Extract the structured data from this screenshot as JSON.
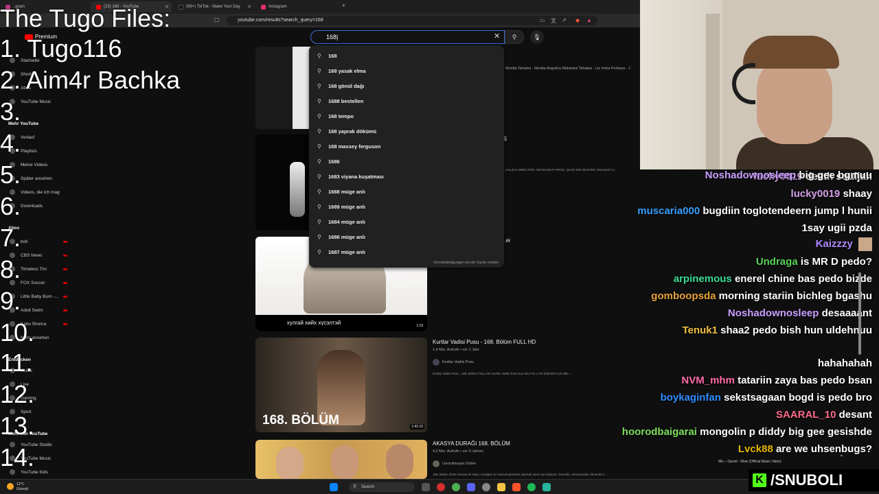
{
  "browser": {
    "tabs": [
      {
        "label": "..gram",
        "color": "#c13584"
      },
      {
        "label": "(23) 168 - YouTube",
        "color": "#ff0000"
      },
      {
        "label": "(99+) TikTok - Make Your Day",
        "color": "#111111"
      },
      {
        "label": "Instagram",
        "color": "#e1306c"
      }
    ],
    "new_tab": "+",
    "url": "youtube.com/results?search_query=168"
  },
  "overlay": {
    "title": "The Tugo Files:",
    "lines": [
      "1. Tugo116",
      "2.  Aim4r Bachka",
      "3.",
      "4.",
      "5.",
      "6.",
      "7.",
      "8.",
      "9.",
      "10.",
      "11.",
      "12.",
      "13.",
      "14."
    ]
  },
  "youtube": {
    "logo": "Premium",
    "search_value": "168",
    "sidebar": {
      "items": [
        "Startseite",
        "Shorts",
        "Abos",
        "YouTube Music",
        "Mehr YouTube",
        "Verlauf",
        "Playlists",
        "Meine Videos",
        "Später ansehen",
        "Videos, die ich mag",
        "Downloads",
        "Abos",
        "boll",
        "CBS News",
        "Timeless Tim",
        "FOX Soccer",
        "Little Baby Bum -...",
        "Adult Swim",
        "Kaito Shoma",
        "Mehr ansehen",
        "Entdecken",
        "Musik",
        "Live",
        "Gaming",
        "Sport",
        "Mehr von YouTube",
        "YouTube Studio",
        "YouTube Music",
        "YouTube Kids"
      ]
    },
    "suggestions": [
      "168",
      "168 yasak elma",
      "168 gönül dağı",
      "1688 bestellen",
      "168 tempo",
      "168 yaprak dökümü",
      "168 massey ferguson",
      "1686",
      "1683 viyana kuşatması",
      "1688 müge anlı",
      "1689 müge anlı",
      "1684 müge anlı",
      "1686 müge anlı",
      "1687 müge anlı"
    ],
    "report_link": "Vervollständigungen bei der Suche melden",
    "results": [
      {
        "meta": "Monita Tahalea · Monita Angelica Maharani Tahalea · Lie Indra Perkasa · J"
      },
      {
        "title": "...S",
        "meta": "HALZAA DIRECTOR, ABYSS BEAT PROD. QUAD MIX MASTER, REALEST U..."
      },
      {
        "title": "...ei",
        "thumb_caption": "хулгай хийх хүсэлтэй",
        "duration": "1:19"
      },
      {
        "title": "Kurtlar Vadisi Pusu - 168. Bölüm FULL HD",
        "views": "1,4 Mio. Aufrufe • vor 1 Jahr",
        "channel": "Kurtlar Vadisi Pusu",
        "desc": "Kurtlar Vadisi Pusu - 168. Bölüm FULL HD Kurtlar Vadisi Pusu'nun tüm FULL HD bölümleri için tıkla ...",
        "thumb_caption": "168. BÖLÜM",
        "duration": "1:41:10"
      },
      {
        "title": "AKASYA DURAĞI 168. BÖLÜM",
        "views": "4,2 Mio. Aufrufe • vor 9 Jahren",
        "channel": "Unutulmayan Diziler",
        "desc": "168. Bölüm Özeti Osman ile Hayri, Karagöz ve Hacivat gösterisi yapmak üzere işe başlıyor. Güverlin, Almanya'dan dönenlerci ..."
      }
    ]
  },
  "chat": [
    {
      "user": "lucky0019",
      "msg": "death souljah",
      "color": "#d4a0e8"
    },
    {
      "user": "lucky0019",
      "msg": "shaay",
      "color": "#d4a0e8"
    },
    {
      "user": "muscaria000",
      "msg": "bugdiin toglotendeern jump l hunii",
      "msg2": "1say ugii pzda",
      "color": "#3aa0ff"
    },
    {
      "user": "Kaizzzy",
      "msg": "",
      "color": "#b388ff"
    },
    {
      "user": "Undraga",
      "msg": "is MR D pedo?",
      "color": "#5bd15b"
    },
    {
      "user": "arpinemous",
      "msg": "enerel chine bas pedo bizde",
      "color": "#3ddc97"
    },
    {
      "user": "gomboopsda",
      "msg": "morning stariin bichleg bgashu",
      "color": "#e6a23c"
    },
    {
      "user": "Noshadownosleep",
      "msg": "desaaaant",
      "color": "#c9a0ff"
    },
    {
      "user": "Tenuk1",
      "msg": "shaa2 pedo bish hun uldehnuu",
      "msg2": "hahahahah",
      "color": "#f0c040"
    },
    {
      "user": "NVM_mhm",
      "msg": "tatariin zaya bas pedo bsan",
      "color": "#ff6ba8"
    },
    {
      "user": "boykaginfan",
      "msg": "sekstsagaan bogd is pedo bro",
      "color": "#2f8cff"
    },
    {
      "user": "SAARAL_10",
      "msg": "desant",
      "color": "#ff6b8a"
    },
    {
      "user": "hoorodbaigarai",
      "msg": "mongolin p diddy big gee gesishde",
      "color": "#7be05b"
    },
    {
      "user": "Lvck88",
      "msg": "are we uhsenbugs?",
      "color": "#e6b800"
    },
    {
      "user": "Noshadownosleep",
      "msg": "big gee bgmuu",
      "color": "#c9a0ff"
    }
  ],
  "now_playing": "Mix – Opozit - Wow (Official Music Video)",
  "taskbar": {
    "weather_temp": "12°C",
    "weather_desc": "Güneşli",
    "search": "Search"
  },
  "branding": {
    "name": "/SNUBOLI",
    "kick": "K"
  }
}
